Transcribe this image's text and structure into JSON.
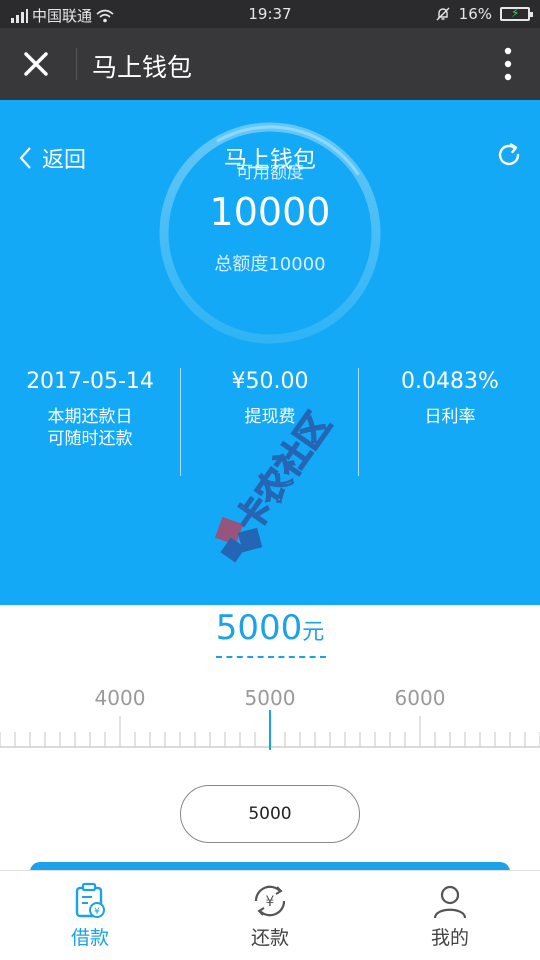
{
  "status_bar": {
    "carrier": "中国联通",
    "time": "19:37",
    "battery": "16%"
  },
  "nav": {
    "title": "马上钱包"
  },
  "hero": {
    "back_label": "返回",
    "title": "马上钱包",
    "credit_label": "可用额度",
    "credit_amount": "10000",
    "total_limit": "总额度10000"
  },
  "stats": [
    {
      "value": "2017-05-14",
      "label": "本期还款日",
      "sub": "可随时还款"
    },
    {
      "value": "¥50.00",
      "label": "提现费"
    },
    {
      "value": "0.0483%",
      "label": "日利率"
    }
  ],
  "loan": {
    "selected_amount": "5000",
    "unit": "元",
    "ruler_labels": [
      "4000",
      "5000",
      "6000"
    ],
    "input_value": "5000"
  },
  "tabs": [
    {
      "label": "借款",
      "icon": "loan-icon",
      "active": true
    },
    {
      "label": "还款",
      "icon": "repay-icon",
      "active": false
    },
    {
      "label": "我的",
      "icon": "profile-icon",
      "active": false
    }
  ],
  "colors": {
    "hero_blue": "#13a9f7",
    "accent_blue": "#1aa3e8",
    "nav_dark": "#38383a"
  }
}
